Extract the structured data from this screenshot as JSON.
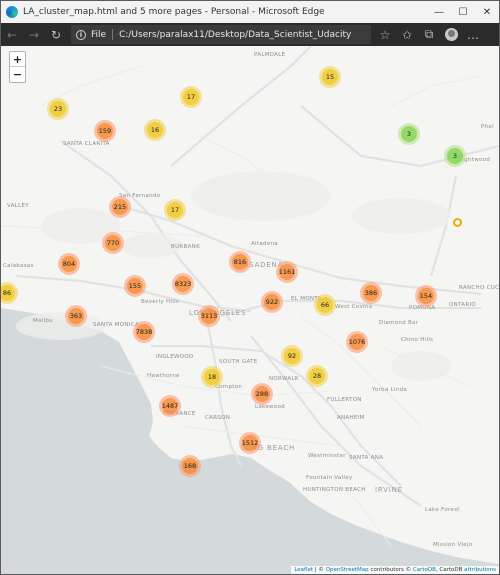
{
  "window": {
    "title": "LA_cluster_map.html and 5 more pages - Personal - Microsoft Edge",
    "controls": {
      "minimize": "—",
      "maximize": "☐",
      "close": "✕"
    }
  },
  "toolbar": {
    "back": "←",
    "forward": "→",
    "refresh": "↻",
    "file_label": "File",
    "url": "C:/Users/paralax11/Desktop/Data_Scientist_Udacity/Data..."
  },
  "map": {
    "zoom_in": "+",
    "zoom_out": "−",
    "places": [
      {
        "name": "PALMDALE",
        "cls": ""
      },
      {
        "name": "SANTA CLARITA",
        "cls": ""
      },
      {
        "name": "San Fernando",
        "cls": ""
      },
      {
        "name": "VALLEY",
        "cls": ""
      },
      {
        "name": "BURBANK",
        "cls": ""
      },
      {
        "name": "Altadena",
        "cls": ""
      },
      {
        "name": "PASADENA",
        "cls": "big"
      },
      {
        "name": "Beverly Hills",
        "cls": ""
      },
      {
        "name": "LOS ANGELES",
        "cls": "big"
      },
      {
        "name": "SANTA MONICA",
        "cls": ""
      },
      {
        "name": "Malibu",
        "cls": ""
      },
      {
        "name": "Calabasas",
        "cls": ""
      },
      {
        "name": "INGLEWOOD",
        "cls": ""
      },
      {
        "name": "Hawthorne",
        "cls": ""
      },
      {
        "name": "SOUTH GATE",
        "cls": ""
      },
      {
        "name": "Compton",
        "cls": ""
      },
      {
        "name": "TORRANCE",
        "cls": ""
      },
      {
        "name": "CARSON",
        "cls": ""
      },
      {
        "name": "LONG BEACH",
        "cls": "big"
      },
      {
        "name": "Lakewood",
        "cls": ""
      },
      {
        "name": "NORWALK",
        "cls": ""
      },
      {
        "name": "EL MONTE",
        "cls": ""
      },
      {
        "name": "West Covina",
        "cls": ""
      },
      {
        "name": "POMONA",
        "cls": ""
      },
      {
        "name": "ONTARIO",
        "cls": ""
      },
      {
        "name": "Diamond Bar",
        "cls": ""
      },
      {
        "name": "Chino Hills",
        "cls": ""
      },
      {
        "name": "FULLERTON",
        "cls": ""
      },
      {
        "name": "Yorba Linda",
        "cls": ""
      },
      {
        "name": "ANAHEIM",
        "cls": ""
      },
      {
        "name": "Westminster",
        "cls": ""
      },
      {
        "name": "SANTA ANA",
        "cls": ""
      },
      {
        "name": "HUNTINGTON BEACH",
        "cls": ""
      },
      {
        "name": "Fountain Valley",
        "cls": ""
      },
      {
        "name": "IRVINE",
        "cls": "big"
      },
      {
        "name": "Lake Forest",
        "cls": ""
      },
      {
        "name": "RANCHO CUC",
        "cls": ""
      },
      {
        "name": "Phel",
        "cls": ""
      },
      {
        "name": "Lightwood",
        "cls": ""
      },
      {
        "name": "Mission Viejo",
        "cls": ""
      }
    ],
    "clusters": [
      {
        "count": "15",
        "size": "medium"
      },
      {
        "count": "23",
        "size": "medium"
      },
      {
        "count": "17",
        "size": "medium"
      },
      {
        "count": "159",
        "size": "large"
      },
      {
        "count": "16",
        "size": "medium"
      },
      {
        "count": "3",
        "size": "small"
      },
      {
        "count": "3",
        "size": "small"
      },
      {
        "count": "215",
        "size": "large"
      },
      {
        "count": "17",
        "size": "medium"
      },
      {
        "count": "770",
        "size": "large"
      },
      {
        "count": "804",
        "size": "large"
      },
      {
        "count": "816",
        "size": "large"
      },
      {
        "count": "1161",
        "size": "large"
      },
      {
        "count": "86",
        "size": "medium"
      },
      {
        "count": "155",
        "size": "large"
      },
      {
        "count": "8323",
        "size": "large"
      },
      {
        "count": "922",
        "size": "large"
      },
      {
        "count": "66",
        "size": "medium"
      },
      {
        "count": "386",
        "size": "large"
      },
      {
        "count": "154",
        "size": "large"
      },
      {
        "count": "363",
        "size": "large"
      },
      {
        "count": "7838",
        "size": "large"
      },
      {
        "count": "3113",
        "size": "large"
      },
      {
        "count": "1076",
        "size": "large"
      },
      {
        "count": "92",
        "size": "medium"
      },
      {
        "count": "18",
        "size": "medium"
      },
      {
        "count": "28",
        "size": "medium"
      },
      {
        "count": "288",
        "size": "large"
      },
      {
        "count": "1487",
        "size": "large"
      },
      {
        "count": "1512",
        "size": "large"
      },
      {
        "count": "168",
        "size": "large"
      }
    ],
    "attribution": {
      "leaflet": "Leaflet",
      "sep": " | © ",
      "osm": "OpenStreetMap",
      "mid": " contributors © ",
      "carto": "CartoDB",
      "mid2": ", CartoDB ",
      "attr": "attributions"
    }
  }
}
